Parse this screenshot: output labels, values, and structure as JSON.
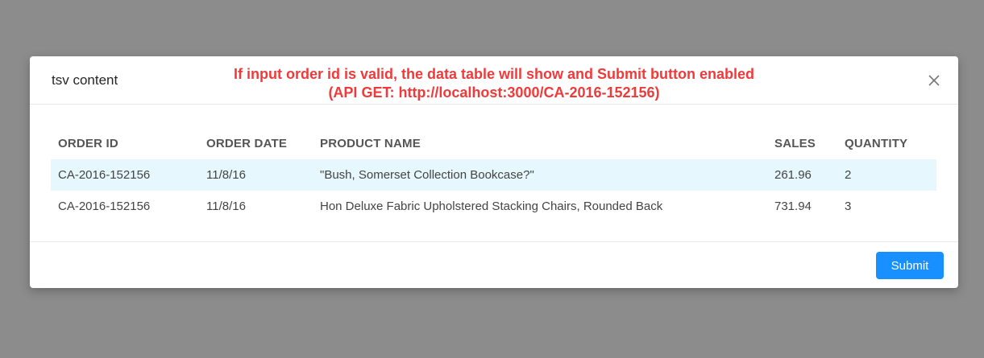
{
  "modal": {
    "title": "tsv content",
    "annotation_line1": "If input order id is valid, the data table will show and Submit button enabled",
    "annotation_line2": "(API GET: http://localhost:3000/CA-2016-152156)",
    "close_icon": "close-icon"
  },
  "table": {
    "headers": [
      "ORDER ID",
      "ORDER DATE",
      "PRODUCT NAME",
      "SALES",
      "QUANTITY"
    ],
    "rows": [
      [
        "CA-2016-152156",
        "11/8/16",
        "\"Bush, Somerset Collection Bookcase?\"",
        "261.96",
        "2"
      ],
      [
        "CA-2016-152156",
        "11/8/16",
        "Hon Deluxe Fabric Upholstered Stacking Chairs, Rounded Back",
        "731.94",
        "3"
      ]
    ],
    "highlight_color": "#e6f7fd"
  },
  "footer": {
    "submit_label": "Submit",
    "submit_color": "#1890ff"
  },
  "colors": {
    "overlay": "#8c8c8c",
    "annotation": "#f03a3a"
  }
}
